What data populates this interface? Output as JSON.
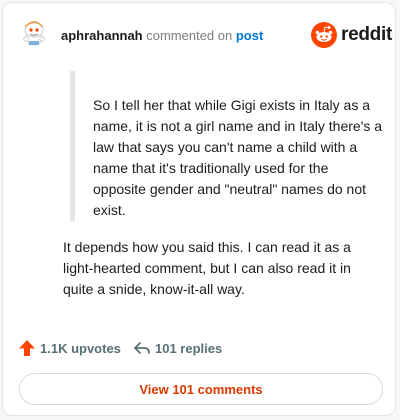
{
  "header": {
    "username": "aphrahannah",
    "action_text": " commented on ",
    "post_link": "post",
    "logo_text": "reddit"
  },
  "comment": {
    "quote": "So I tell her that while Gigi exists in Italy as a name, it is not a girl name and in Italy there's a law that says you can't name a child with a name that it's traditionally used for the opposite gender and \"neutral\" names do not exist.",
    "body": "It depends how you said this. I can read it as a light-hearted comment, but I can also read it in quite a snide, know-it-all way."
  },
  "actions": {
    "upvotes": "1.1K upvotes",
    "replies": "101 replies",
    "view_comments": "View 101 comments"
  },
  "colors": {
    "brand": "#ff4500",
    "link": "#0079d3",
    "view_button_text": "#d93a00",
    "muted": "#576f76"
  }
}
